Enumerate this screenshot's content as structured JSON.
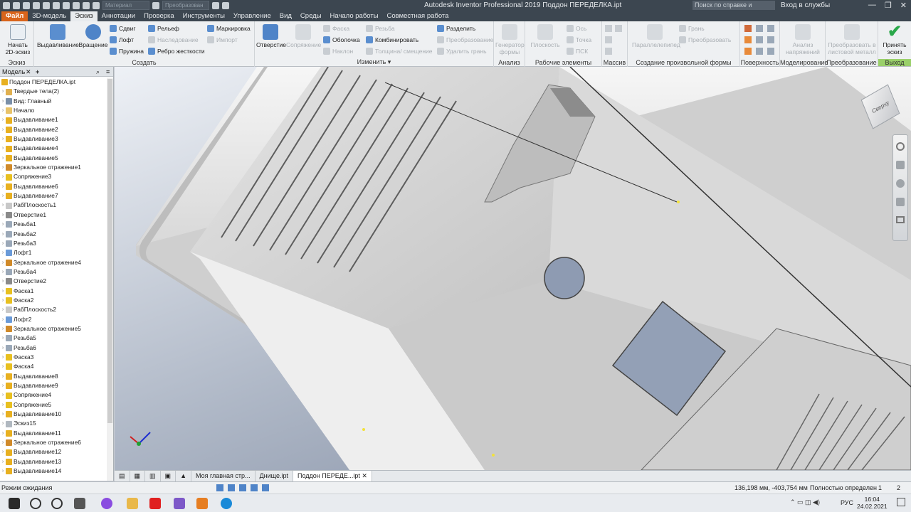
{
  "titlebar": {
    "title": "Autodesk Inventor Professional 2019   Поддон ПЕРЕДЕЛКА.ipt",
    "material_placeholder": "Материал",
    "appearance_placeholder": "Преобразован",
    "search_placeholder": "Поиск по справке и командам",
    "login": "Вход в службы"
  },
  "tabs": [
    "Файл",
    "3D-модель",
    "Эскиз",
    "Аннотации",
    "Проверка",
    "Инструменты",
    "Управление",
    "Вид",
    "Среды",
    "Начало работы",
    "Совместная работа"
  ],
  "ribbon": {
    "sketch": {
      "start": "Начать 2D-эскиз",
      "label": "Эскиз"
    },
    "create": {
      "extrude": "Выдавливание",
      "revolve": "Вращение",
      "sweep": "Сдвиг",
      "loft": "Лофт",
      "coil": "Пружина",
      "emboss": "Рельеф",
      "derive": "Наследование",
      "rib": "Ребро жесткости",
      "mark": "Маркировка",
      "import": "Импорт",
      "label": "Создать"
    },
    "modify": {
      "hole": "Отверстие",
      "fillet": "Сопряжение",
      "chamfer": "Фаска",
      "shell": "Оболочка",
      "draft": "Наклон",
      "thread": "Резьба",
      "combine": "Комбинировать",
      "thicken": "Толщина/ смещение",
      "split": "Разделить",
      "transform": "Преобразование",
      "delete_face": "Удалить грань",
      "label": "Изменить"
    },
    "explore": {
      "generator": "Генератор формы",
      "label": "Анализ"
    },
    "work": {
      "plane": "Плоскость",
      "axis": "Ось",
      "point": "Точка",
      "ucs": "ПСК",
      "label": "Рабочие элементы"
    },
    "pattern": {
      "label": "Массив"
    },
    "freeform": {
      "box": "Параллелепипед",
      "face": "Грань",
      "convert": "Преобразовать",
      "label": "Создание произвольной формы"
    },
    "surface": {
      "label": "Поверхность"
    },
    "simulation": {
      "stress": "Анализ напряжений",
      "label": "Моделирование"
    },
    "convert": {
      "sheet": "Преобразовать в листовой металл",
      "label": "Преобразование"
    },
    "exit": {
      "finish": "Принять эскиз",
      "label": "Выход"
    }
  },
  "browser": {
    "title": "Модель",
    "root": "Поддон ПЕРЕДЕЛКА.ipt",
    "items": [
      {
        "label": "Твердые тела(2)",
        "icon": "solid-bodies-icon",
        "color": "#e0b050"
      },
      {
        "label": "Вид: Главный",
        "icon": "view-icon",
        "color": "#7a8fa8"
      },
      {
        "label": "Начало",
        "icon": "folder-icon",
        "color": "#e8c36a"
      },
      {
        "label": "Выдавливание1",
        "icon": "extrude-icon",
        "color": "#e8b020"
      },
      {
        "label": "Выдавливание2",
        "icon": "extrude-icon",
        "color": "#e8b020"
      },
      {
        "label": "Выдавливание3",
        "icon": "extrude-icon",
        "color": "#e8b020"
      },
      {
        "label": "Выдавливание4",
        "icon": "extrude-icon",
        "color": "#e8b020"
      },
      {
        "label": "Выдавливание5",
        "icon": "extrude-icon",
        "color": "#e8b020"
      },
      {
        "label": "Зеркальное отражение1",
        "icon": "mirror-icon",
        "color": "#d08a2a"
      },
      {
        "label": "Сопряжение3",
        "icon": "fillet-icon",
        "color": "#e8c020"
      },
      {
        "label": "Выдавливание6",
        "icon": "extrude-icon",
        "color": "#e8b020"
      },
      {
        "label": "Выдавливание7",
        "icon": "extrude-icon",
        "color": "#e8b020"
      },
      {
        "label": "РабПлоскость1",
        "icon": "work-plane-icon",
        "color": "#c8c8c8"
      },
      {
        "label": "Отверстие1",
        "icon": "hole-icon",
        "color": "#8a8a8a"
      },
      {
        "label": "Резьба1",
        "icon": "thread-icon",
        "color": "#9aa8b8"
      },
      {
        "label": "Резьба2",
        "icon": "thread-icon",
        "color": "#9aa8b8"
      },
      {
        "label": "Резьба3",
        "icon": "thread-icon",
        "color": "#9aa8b8"
      },
      {
        "label": "Лофт1",
        "icon": "loft-icon",
        "color": "#6a9ad8"
      },
      {
        "label": "Зеркальное отражение4",
        "icon": "mirror-icon",
        "color": "#d08a2a"
      },
      {
        "label": "Резьба4",
        "icon": "thread-icon",
        "color": "#9aa8b8"
      },
      {
        "label": "Отверстие2",
        "icon": "hole-icon",
        "color": "#8a8a8a"
      },
      {
        "label": "Фаска1",
        "icon": "chamfer-icon",
        "color": "#e8c020"
      },
      {
        "label": "Фаска2",
        "icon": "chamfer-icon",
        "color": "#e8c020"
      },
      {
        "label": "РабПлоскость2",
        "icon": "work-plane-icon",
        "color": "#c8c8c8"
      },
      {
        "label": "Лофт2",
        "icon": "loft-icon",
        "color": "#6a9ad8"
      },
      {
        "label": "Зеркальное отражение5",
        "icon": "mirror-icon",
        "color": "#d08a2a"
      },
      {
        "label": "Резьба5",
        "icon": "thread-icon",
        "color": "#9aa8b8"
      },
      {
        "label": "Резьба6",
        "icon": "thread-icon",
        "color": "#9aa8b8"
      },
      {
        "label": "Фаска3",
        "icon": "chamfer-icon",
        "color": "#e8c020"
      },
      {
        "label": "Фаска4",
        "icon": "chamfer-icon",
        "color": "#e8c020"
      },
      {
        "label": "Выдавливание8",
        "icon": "extrude-icon",
        "color": "#e8b020"
      },
      {
        "label": "Выдавливание9",
        "icon": "extrude-icon",
        "color": "#e8b020"
      },
      {
        "label": "Сопряжение4",
        "icon": "fillet-icon",
        "color": "#e8c020"
      },
      {
        "label": "Сопряжение5",
        "icon": "fillet-icon",
        "color": "#e8c020"
      },
      {
        "label": "Выдавливание10",
        "icon": "extrude-icon",
        "color": "#e8b020"
      },
      {
        "label": "Эскиз15",
        "icon": "sketch-icon",
        "color": "#b0b8c0"
      },
      {
        "label": "Выдавливание11",
        "icon": "extrude-icon",
        "color": "#e8b020"
      },
      {
        "label": "Зеркальное отражение6",
        "icon": "mirror-icon",
        "color": "#d08a2a"
      },
      {
        "label": "Выдавливание12",
        "icon": "extrude-icon",
        "color": "#e8b020"
      },
      {
        "label": "Выдавливание13",
        "icon": "extrude-icon",
        "color": "#e8b020"
      },
      {
        "label": "Выдавливание14",
        "icon": "extrude-icon",
        "color": "#e8b020"
      }
    ]
  },
  "viewcube": {
    "label": "Сверху"
  },
  "doc_tabs": [
    "Моя главная стр...",
    "Днище.ipt",
    "Поддон ПЕРЕДЕ...ipt"
  ],
  "status": {
    "mode": "Режим ожидания",
    "coords": "136,198 мм, -403,754 мм",
    "constraint": "Полностью определен",
    "count1": "1",
    "count2": "2"
  },
  "taskbar": {
    "lang": "РУС",
    "time": "16:04",
    "date": "24.02.2021"
  }
}
